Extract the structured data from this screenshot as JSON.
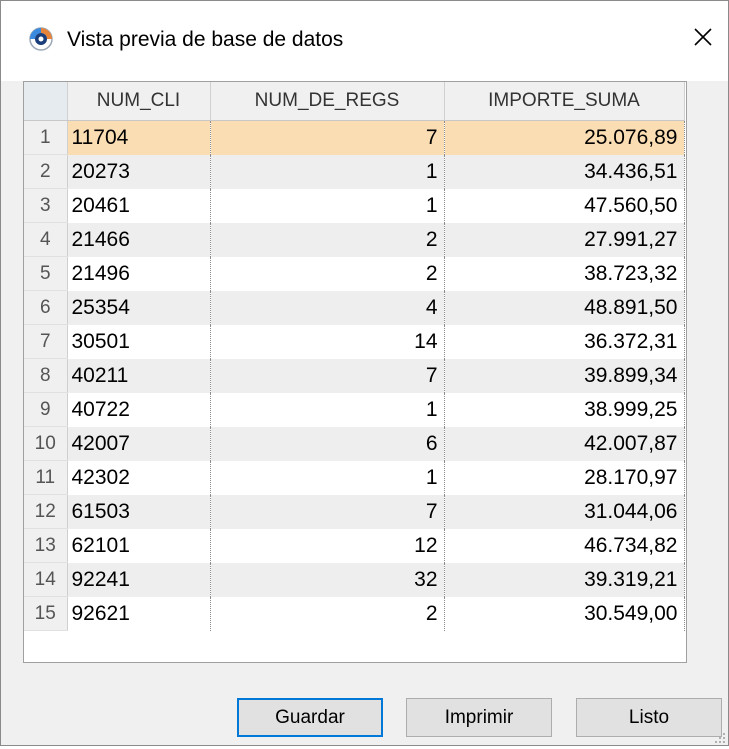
{
  "window": {
    "title": "Vista previa de base de datos"
  },
  "icons": {
    "app": "app-logo-icon",
    "close": "close-icon",
    "resize": "resize-grip-icon"
  },
  "colors": {
    "selected_row": "#fbddb3",
    "alt_row": "#eeeeee",
    "default_button_border": "#0078d7"
  },
  "grid": {
    "columns": [
      "NUM_CLI",
      "NUM_DE_REGS",
      "IMPORTE_SUMA"
    ],
    "selected_row": 1,
    "rows": [
      {
        "idx": "1",
        "num_cli": "11704",
        "num_de_regs": "7",
        "importe_suma": "25.076,89"
      },
      {
        "idx": "2",
        "num_cli": "20273",
        "num_de_regs": "1",
        "importe_suma": "34.436,51"
      },
      {
        "idx": "3",
        "num_cli": "20461",
        "num_de_regs": "1",
        "importe_suma": "47.560,50"
      },
      {
        "idx": "4",
        "num_cli": "21466",
        "num_de_regs": "2",
        "importe_suma": "27.991,27"
      },
      {
        "idx": "5",
        "num_cli": "21496",
        "num_de_regs": "2",
        "importe_suma": "38.723,32"
      },
      {
        "idx": "6",
        "num_cli": "25354",
        "num_de_regs": "4",
        "importe_suma": "48.891,50"
      },
      {
        "idx": "7",
        "num_cli": "30501",
        "num_de_regs": "14",
        "importe_suma": "36.372,31"
      },
      {
        "idx": "8",
        "num_cli": "40211",
        "num_de_regs": "7",
        "importe_suma": "39.899,34"
      },
      {
        "idx": "9",
        "num_cli": "40722",
        "num_de_regs": "1",
        "importe_suma": "38.999,25"
      },
      {
        "idx": "10",
        "num_cli": "42007",
        "num_de_regs": "6",
        "importe_suma": "42.007,87"
      },
      {
        "idx": "11",
        "num_cli": "42302",
        "num_de_regs": "1",
        "importe_suma": "28.170,97"
      },
      {
        "idx": "12",
        "num_cli": "61503",
        "num_de_regs": "7",
        "importe_suma": "31.044,06"
      },
      {
        "idx": "13",
        "num_cli": "62101",
        "num_de_regs": "12",
        "importe_suma": "46.734,82"
      },
      {
        "idx": "14",
        "num_cli": "92241",
        "num_de_regs": "32",
        "importe_suma": "39.319,21"
      },
      {
        "idx": "15",
        "num_cli": "92621",
        "num_de_regs": "2",
        "importe_suma": "30.549,00"
      }
    ]
  },
  "buttons": {
    "save": "Guardar",
    "print": "Imprimir",
    "done": "Listo"
  }
}
